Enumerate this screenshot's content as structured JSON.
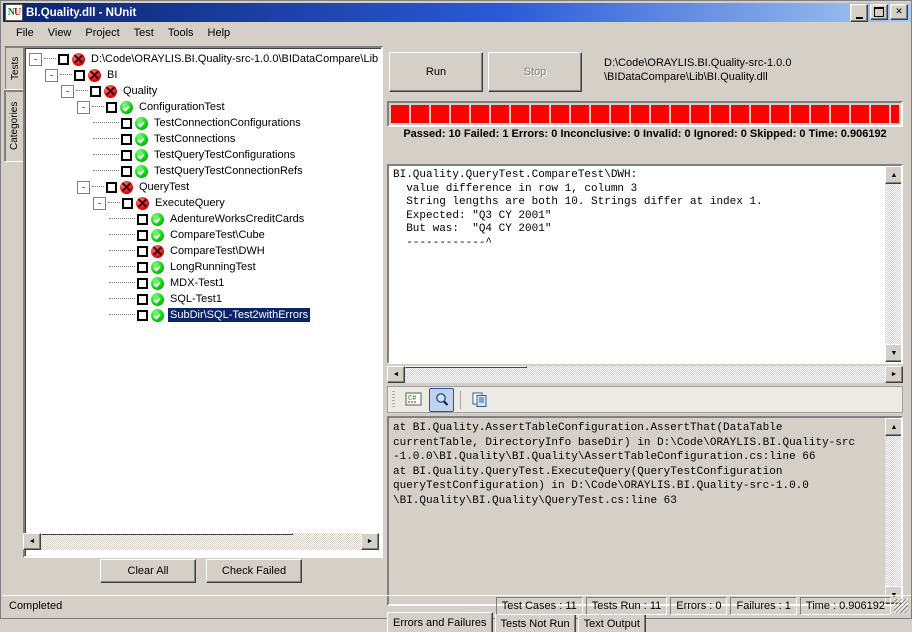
{
  "window": {
    "title": "BI.Quality.dll - NUnit",
    "icon": "nunit-logo-icon",
    "minimize": "_",
    "maximize": "□",
    "close": "✕"
  },
  "menubar": {
    "items": [
      "File",
      "View",
      "Project",
      "Test",
      "Tools",
      "Help"
    ]
  },
  "left_tabs": {
    "items": [
      {
        "label": "Tests",
        "selected": true
      },
      {
        "label": "Categories",
        "selected": false
      }
    ]
  },
  "tree": {
    "nodes": [
      {
        "level": 0,
        "expander": "-",
        "checkbox": true,
        "status": "fail",
        "label": "D:\\Code\\ORAYLIS.BI.Quality-src-1.0.0\\BIDataCompare\\Lib",
        "selected": false
      },
      {
        "level": 1,
        "expander": "-",
        "checkbox": true,
        "status": "fail",
        "label": "BI",
        "selected": false
      },
      {
        "level": 2,
        "expander": "-",
        "checkbox": true,
        "status": "fail",
        "label": "Quality",
        "selected": false
      },
      {
        "level": 3,
        "expander": "-",
        "checkbox": true,
        "status": "pass",
        "label": "ConfigurationTest",
        "selected": false
      },
      {
        "level": 4,
        "expander": "",
        "checkbox": true,
        "status": "pass",
        "label": "TestConnectionConfigurations",
        "selected": false
      },
      {
        "level": 4,
        "expander": "",
        "checkbox": true,
        "status": "pass",
        "label": "TestConnections",
        "selected": false
      },
      {
        "level": 4,
        "expander": "",
        "checkbox": true,
        "status": "pass",
        "label": "TestQueryTestConfigurations",
        "selected": false
      },
      {
        "level": 4,
        "expander": "",
        "checkbox": true,
        "status": "pass",
        "label": "TestQueryTestConnectionRefs",
        "selected": false
      },
      {
        "level": 3,
        "expander": "-",
        "checkbox": true,
        "status": "fail",
        "label": "QueryTest",
        "selected": false
      },
      {
        "level": 4,
        "expander": "-",
        "checkbox": true,
        "status": "fail",
        "label": "ExecuteQuery",
        "selected": false
      },
      {
        "level": 5,
        "expander": "",
        "checkbox": true,
        "status": "pass",
        "label": "AdentureWorksCreditCards",
        "selected": false
      },
      {
        "level": 5,
        "expander": "",
        "checkbox": true,
        "status": "pass",
        "label": "CompareTest\\Cube",
        "selected": false
      },
      {
        "level": 5,
        "expander": "",
        "checkbox": true,
        "status": "fail",
        "label": "CompareTest\\DWH",
        "selected": false
      },
      {
        "level": 5,
        "expander": "",
        "checkbox": true,
        "status": "pass",
        "label": "LongRunningTest",
        "selected": false
      },
      {
        "level": 5,
        "expander": "",
        "checkbox": true,
        "status": "pass",
        "label": "MDX-Test1",
        "selected": false
      },
      {
        "level": 5,
        "expander": "",
        "checkbox": true,
        "status": "pass",
        "label": "SQL-Test1",
        "selected": false
      },
      {
        "level": 5,
        "expander": "",
        "checkbox": true,
        "status": "pass",
        "label": "SubDir\\SQL-Test2withErrors",
        "selected": true
      }
    ]
  },
  "tree_buttons": {
    "clear_all": "Clear All",
    "check_failed": "Check Failed"
  },
  "run_panel": {
    "run_label": "Run",
    "stop_label": "Stop",
    "assembly_path_line1": "D:\\Code\\ORAYLIS.BI.Quality-src-1.0.0",
    "assembly_path_line2": "\\BIDataCompare\\Lib\\BI.Quality.dll"
  },
  "progress": {
    "color": "#ff0000",
    "segments": 28,
    "summary": "Passed: 10 Failed: 1 Errors: 0 Inconclusive: 0 Invalid: 0 Ignored: 0 Skipped: 0 Time: 0.906192"
  },
  "errors_output": {
    "text": "BI.Quality.QueryTest.CompareTest\\DWH:\n  value difference in row 1, column 3\n  String lengths are both 10. Strings differ at index 1.\n  Expected: \"Q3 CY 2001\"\n  But was:  \"Q4 CY 2001\"\n  ------------^"
  },
  "stack_toolbar": {
    "buttons": [
      {
        "name": "source-code-icon",
        "active": false
      },
      {
        "name": "magnifier-icon",
        "active": true
      },
      {
        "name": "copy-icon",
        "active": false
      }
    ]
  },
  "stack_trace": {
    "text": "at BI.Quality.AssertTableConfiguration.AssertThat(DataTable\ncurrentTable, DirectoryInfo baseDir) in D:\\Code\\ORAYLIS.BI.Quality-src\n-1.0.0\\BI.Quality\\BI.Quality\\AssertTableConfiguration.cs:line 66\nat BI.Quality.QueryTest.ExecuteQuery(QueryTestConfiguration\nqueryTestConfiguration) in D:\\Code\\ORAYLIS.BI.Quality-src-1.0.0\n\\BI.Quality\\BI.Quality\\QueryTest.cs:line 63"
  },
  "bottom_tabs": {
    "items": [
      {
        "label": "Errors and Failures",
        "selected": true
      },
      {
        "label": "Tests Not Run",
        "selected": false
      },
      {
        "label": "Text Output",
        "selected": false
      }
    ]
  },
  "statusbar": {
    "message": "Completed",
    "cells": [
      "Test Cases : 11",
      "Tests Run : 11",
      "Errors : 0",
      "Failures : 1",
      "Time : 0.906192"
    ]
  }
}
